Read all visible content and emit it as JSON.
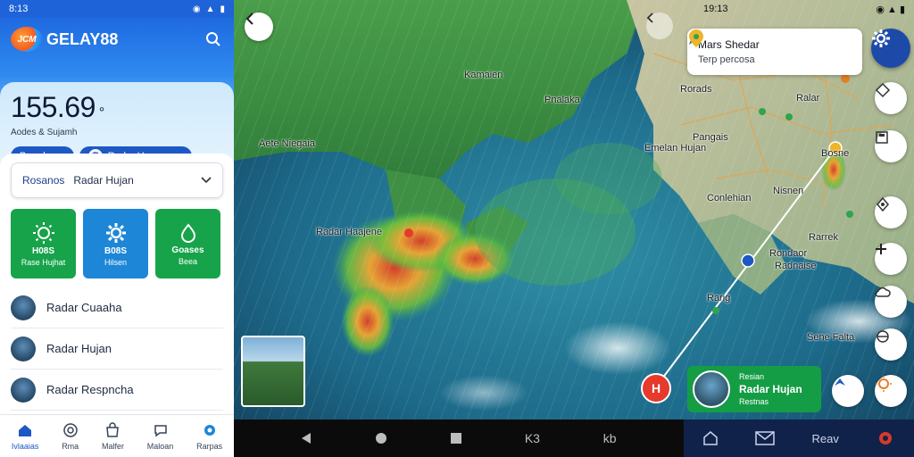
{
  "left_panel": {
    "status_time": "8:13",
    "brand": "GELAY88",
    "logo_text": "JCM",
    "temperature": "155.69",
    "temperature_unit": "°",
    "subtitle": "Aodes & Sujamh",
    "chip_left": "Bogr bene",
    "chip_right": "Radar Hugna",
    "select": {
      "label": "Rosanos",
      "value": "Radar Hujan"
    },
    "tiles": [
      {
        "top": "H08S",
        "bottom": "Rase Hujhat",
        "icon": "sun-icon",
        "color": "#17a34a"
      },
      {
        "top": "B08S",
        "bottom": "Hilsen",
        "icon": "gear-icon",
        "color": "#1d86d6"
      },
      {
        "top": "Goases",
        "bottom": "Beea",
        "icon": "drop-icon",
        "color": "#17a34a"
      }
    ],
    "list": [
      {
        "label": "Radar Cuaaha"
      },
      {
        "label": "Radar Hujan"
      },
      {
        "label": "Radar Respncha"
      }
    ],
    "nav": [
      {
        "label": "Ivlaaias",
        "icon": "home-icon",
        "active": true
      },
      {
        "label": "Rma",
        "icon": "target-icon",
        "active": false
      },
      {
        "label": "Malfer",
        "icon": "bag-icon",
        "active": false
      },
      {
        "label": "Maloan",
        "icon": "chat-icon",
        "active": false
      },
      {
        "label": "Rarpas",
        "icon": "gear-icon",
        "active": false
      }
    ]
  },
  "map": {
    "labels": [
      {
        "text": "Kamaien"
      },
      {
        "text": "Aete Niegaia"
      },
      {
        "text": "Pnalaka"
      },
      {
        "text": "Radar Haajene"
      },
      {
        "text": "Rorads"
      },
      {
        "text": "Pangais"
      },
      {
        "text": "Emelan Hujan"
      },
      {
        "text": "Conlehian"
      },
      {
        "text": "Nisnen"
      },
      {
        "text": "Rarrek"
      },
      {
        "text": "Rondaor"
      },
      {
        "text": "Radnaise"
      },
      {
        "text": "Sene Falta"
      },
      {
        "text": "Ralar"
      },
      {
        "text": "Bosne"
      },
      {
        "text": "Rarig"
      }
    ],
    "info_card": {
      "title": "Mars Shedar",
      "subtitle": "Terp percosa"
    },
    "right_status_time": "19:13",
    "person_card": {
      "line1": "Resian",
      "line2": "Radar Hujan",
      "line3": "Restnas"
    },
    "poi_text": "H"
  },
  "system_nav": {
    "k_label": "K3",
    "kb_label": "kb"
  },
  "app_nav": {
    "text": "Reav"
  }
}
